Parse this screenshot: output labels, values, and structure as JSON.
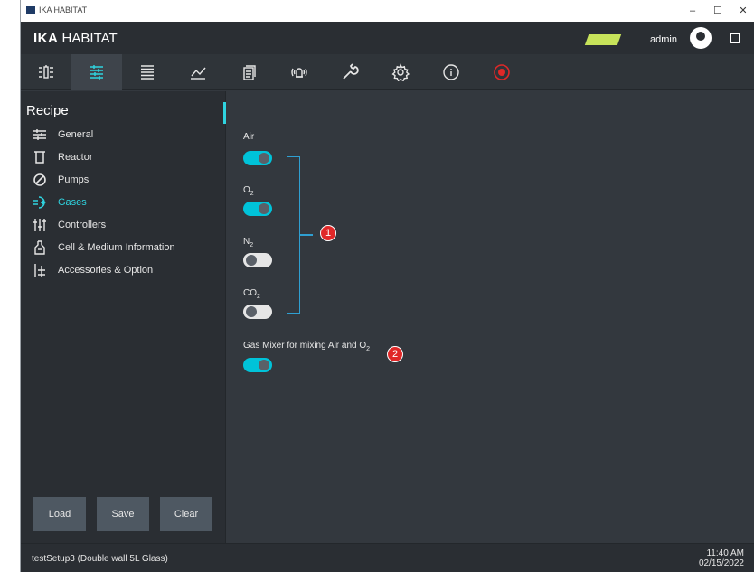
{
  "window": {
    "title": "IKA HABITAT",
    "minimize": "–",
    "maximize": "☐",
    "close": "✕"
  },
  "header": {
    "brand_bold": "IKA",
    "brand_rest": " HABITAT",
    "user": "admin",
    "status_color": "#c7e35a"
  },
  "toolbar": {
    "items": [
      {
        "name": "overview",
        "icon": "overview-icon"
      },
      {
        "name": "recipe",
        "icon": "recipe-sliders-icon",
        "active": true
      },
      {
        "name": "list",
        "icon": "list-icon"
      },
      {
        "name": "chart",
        "icon": "chart-icon"
      },
      {
        "name": "documents",
        "icon": "documents-icon"
      },
      {
        "name": "alarms",
        "icon": "alarm-icon"
      },
      {
        "name": "tools",
        "icon": "wrench-icon"
      },
      {
        "name": "settings",
        "icon": "gear-icon"
      },
      {
        "name": "info",
        "icon": "info-icon"
      },
      {
        "name": "record",
        "icon": "record-icon"
      }
    ]
  },
  "sidebar": {
    "title": "Recipe",
    "items": [
      {
        "label": "General",
        "icon": "sliders-icon"
      },
      {
        "label": "Reactor",
        "icon": "reactor-icon"
      },
      {
        "label": "Pumps",
        "icon": "pump-icon"
      },
      {
        "label": "Gases",
        "icon": "gas-icon",
        "active": true
      },
      {
        "label": "Controllers",
        "icon": "controllers-icon"
      },
      {
        "label": "Cell & Medium Information",
        "icon": "flask-icon"
      },
      {
        "label": "Accessories & Option",
        "icon": "accessories-icon"
      }
    ],
    "buttons": {
      "load": "Load",
      "save": "Save",
      "clear": "Clear"
    }
  },
  "gases": {
    "air": {
      "label": "Air",
      "on": true
    },
    "o2": {
      "label": "O",
      "sub": "2",
      "on": true
    },
    "n2": {
      "label": "N",
      "sub": "2",
      "on": false
    },
    "co2": {
      "label": "CO",
      "sub": "2",
      "on": false
    },
    "mixer": {
      "label": "Gas Mixer for mixing Air and O",
      "sub": "2",
      "on": true
    }
  },
  "markers": {
    "one": "1",
    "two": "2"
  },
  "status": {
    "setup": "testSetup3 (Double wall 5L Glass)",
    "time": "11:40 AM",
    "date": "02/15/2022"
  },
  "colors": {
    "accent": "#2fd4e0",
    "toggle_on": "#00c3d9",
    "marker_red": "#e02828"
  }
}
